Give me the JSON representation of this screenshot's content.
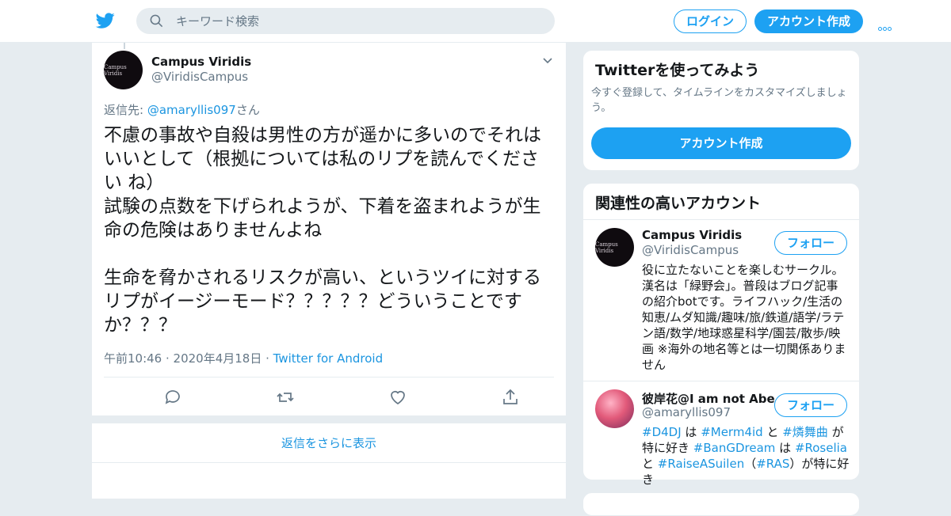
{
  "header": {
    "search_placeholder": "キーワード検索",
    "login_label": "ログイン",
    "signup_label": "アカウント作成"
  },
  "tweet": {
    "name": "Campus Viridis",
    "handle": "@ViridisCampus",
    "avatar_text": "Campus Viridis",
    "reply_prefix": "返信先: ",
    "reply_handle": "@amaryllis097",
    "reply_suffix": "さん",
    "text": "不慮の事故や自殺は男性の方が遥かに多いのでそれはいいとして（根拠については私のリプを読んでください ね）\n試験の点数を下げられようが、下着を盗まれようが生命の危険はありませんよね\n\n生命を脅かされるリスクが高い、というツイに対するリプがイージーモード？？？？？どういうことですか？？？",
    "time": "午前10:46 · 2020年4月18日",
    "via_sep": " · ",
    "client": "Twitter for Android"
  },
  "more_replies_label": "返信をさらに表示",
  "signup_card": {
    "title": "Twitterを使ってみよう",
    "desc": "今すぐ登録して、タイムラインをカスタマイズしましょう。",
    "button": "アカウント作成"
  },
  "related": {
    "title": "関連性の高いアカウント",
    "follow_label": "フォロー",
    "accounts": [
      {
        "name": "Campus Viridis",
        "handle": "@ViridisCampus",
        "avatar_text": "Campus Viridis",
        "bio": "役に立たないことを楽しむサークル。漢名は「緑野会」。普段はブログ記事の紹介botです。ライフハック/生活の知恵/ムダ知識/趣味/旅/鉄道/語学/ラテン語/数学/地球惑星科学/園芸/散歩/映画 ※海外の地名等とは一切関係ありません"
      },
      {
        "name": "彼岸花@I am not Abe",
        "handle": "@amaryllis097",
        "bio_parts": [
          "#D4DJ",
          " は ",
          "#Merm4id",
          " と ",
          "#燐舞曲",
          " が特に好き ",
          "#BanGDream",
          " は ",
          "#Roselia",
          " と ",
          "#RaiseASuilen",
          "（",
          "#RAS",
          "）が特に好き"
        ]
      }
    ]
  },
  "colors": {
    "accent": "#1da1f2",
    "link": "#1b95e0",
    "muted": "#657786"
  }
}
